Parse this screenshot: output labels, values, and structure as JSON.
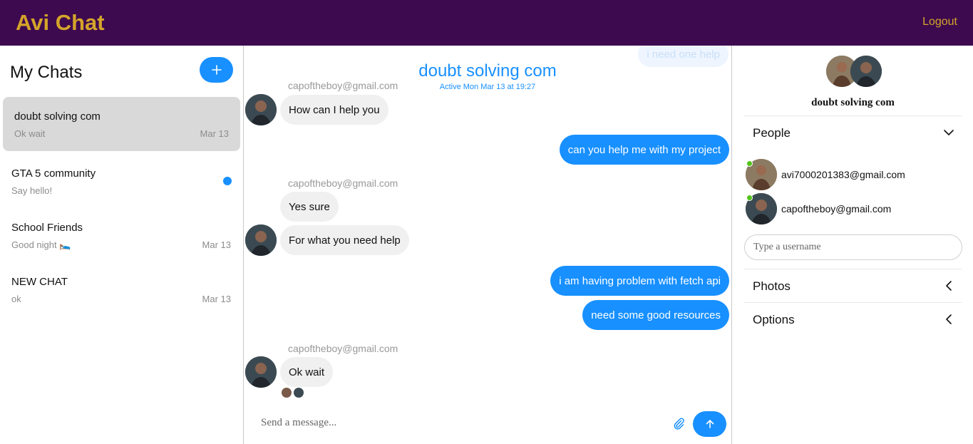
{
  "app": {
    "brand": "Avi Chat",
    "logout_label": "Logout"
  },
  "chats_panel": {
    "title": "My Chats",
    "items": [
      {
        "name": "doubt solving com",
        "last_message": "Ok wait",
        "date": "Mar 13",
        "active": true,
        "unread": false
      },
      {
        "name": "GTA 5 community",
        "last_message": "Say hello!",
        "date": "",
        "active": false,
        "unread": true
      },
      {
        "name": "School Friends",
        "last_message": "Good night 🛌",
        "date": "Mar 13",
        "active": false,
        "unread": false
      },
      {
        "name": "NEW CHAT",
        "last_message": "ok",
        "date": "Mar 13",
        "active": false,
        "unread": false
      }
    ]
  },
  "conversation": {
    "title": "doubt solving com",
    "active_status": "Active Mon Mar 13 at 19:27",
    "messages": [
      {
        "direction": "out",
        "text": "i need one help"
      },
      {
        "direction": "in",
        "sender": "capoftheboy@gmail.com",
        "text": "How can I help you"
      },
      {
        "direction": "out",
        "text": "can you help me with my project"
      },
      {
        "direction": "in",
        "sender": "capoftheboy@gmail.com",
        "text": "Yes sure"
      },
      {
        "direction": "in",
        "text": "For what you need help"
      },
      {
        "direction": "out",
        "text": "i am having problem with fetch api"
      },
      {
        "direction": "out",
        "text": "need some good resources"
      },
      {
        "direction": "in",
        "sender": "capoftheboy@gmail.com",
        "text": "Ok wait"
      }
    ],
    "composer_placeholder": "Send a message..."
  },
  "details_panel": {
    "chat_name": "doubt solving com",
    "people_label": "People",
    "people": [
      {
        "email": "avi7000201383@gmail.com",
        "online": true
      },
      {
        "email": "capoftheboy@gmail.com",
        "online": true
      }
    ],
    "username_placeholder": "Type a username",
    "photos_label": "Photos",
    "options_label": "Options"
  },
  "colors": {
    "header_bg": "#3d0a4f",
    "brand": "#d4a42a",
    "accent": "#1890ff",
    "online": "#52c41a"
  },
  "icons": [
    "plus-icon",
    "paperclip-icon",
    "arrow-up-icon",
    "chevron-down-icon",
    "chevron-left-icon"
  ]
}
